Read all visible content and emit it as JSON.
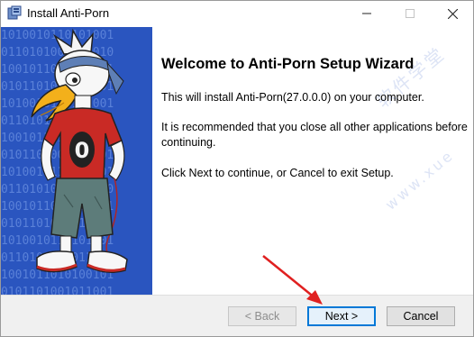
{
  "window": {
    "title": "Install Anti-Porn",
    "icon": "installer-icon"
  },
  "banner": {
    "binary_lines": [
      "1010010110101001",
      "0110101001011010",
      "1001011010100101",
      "0101101001011001",
      "1010010110101001",
      "0110101001011010",
      "1001011010100101",
      "0101101001011001",
      "1010010110101001",
      "0110101001011010",
      "1001011010100101",
      "0101101001011001",
      "1010010110101001",
      "0110101001011010",
      "1001011010100101",
      "0101101001011001"
    ],
    "mascot_shirt_text": "0"
  },
  "content": {
    "heading": "Welcome to Anti-Porn Setup Wizard",
    "p1": "This will install Anti-Porn(27.0.0.0) on your computer.",
    "p2": "It is recommended that you close all other applications before continuing.",
    "p3": "Click Next to continue, or Cancel to exit Setup."
  },
  "buttons": {
    "back": "< Back",
    "next": "Next >",
    "cancel": "Cancel"
  },
  "colors": {
    "banner_blue": "#2a55bf",
    "focus_border": "#0078d7",
    "arrow_red": "#e02020"
  }
}
